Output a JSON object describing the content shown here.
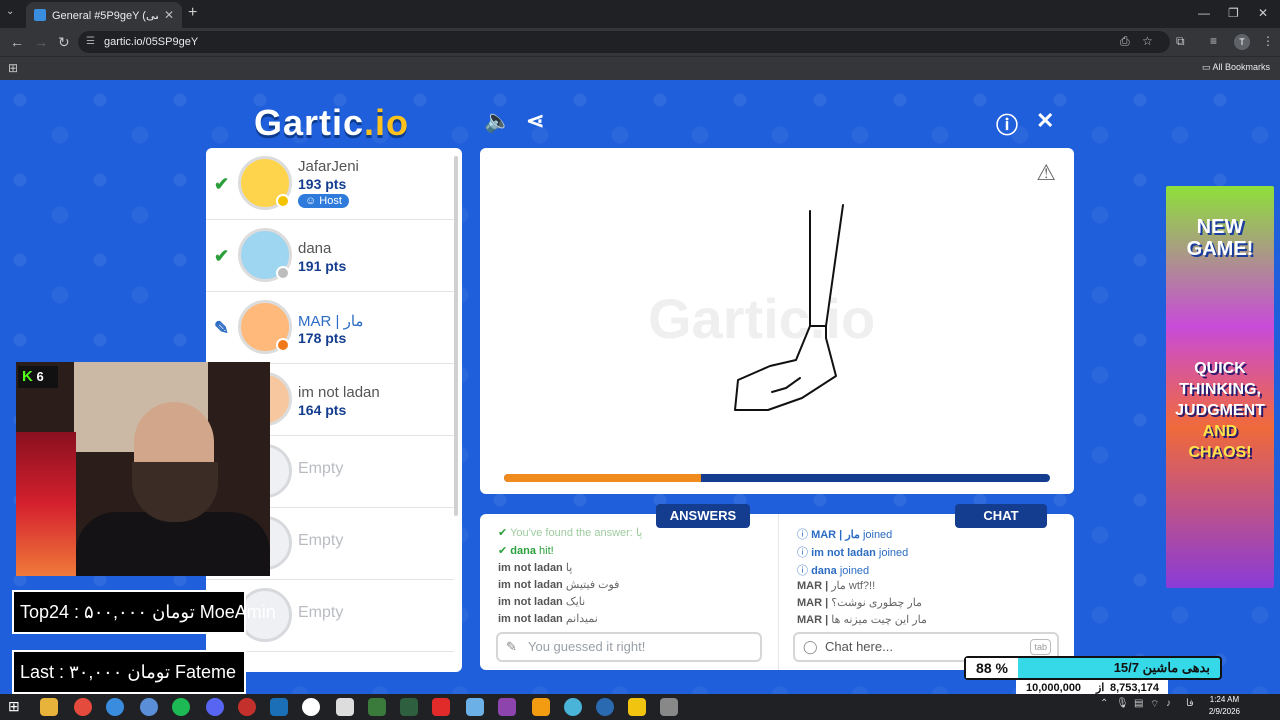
{
  "browser": {
    "tab_title": "General #5P9geY (فارسی) - Gartic",
    "tab_close": "✕",
    "new_tab": "+",
    "url": "gartic.io/05SP9geY",
    "bookmarks_label": "All Bookmarks",
    "profile_initial": "T",
    "menu_icon": "kebab-menu-icon"
  },
  "game": {
    "logo_main": "Gartic",
    "logo_suffix": ".io",
    "players": [
      {
        "name": "JafarJeni",
        "points": "193 pts",
        "status": "guessed",
        "host_label": "Host",
        "avatar_color": "#ffd44d",
        "dot_color": "#f5c400"
      },
      {
        "name": "dana",
        "points": "191 pts",
        "status": "guessed",
        "avatar_color": "#9ed5f0",
        "dot_color": "#bdbdbd"
      },
      {
        "name": "MAR | مار",
        "points": "178 pts",
        "status": "drawing",
        "avatar_color": "#ffb97a",
        "dot_color": "#f07a1a"
      },
      {
        "name": "im not ladan",
        "points": "164 pts",
        "status": "none",
        "avatar_color": "#f7c7a0",
        "dot_color": ""
      },
      {
        "name": "Empty",
        "status": "empty"
      },
      {
        "name": "Empty",
        "status": "empty"
      },
      {
        "name": "Empty",
        "status": "empty"
      }
    ],
    "canvas": {
      "watermark": "Gartic.io",
      "progress_fraction": 0.36
    },
    "answers": {
      "tab_label": "ANSWERS",
      "messages": [
        {
          "user": "",
          "text": "You've found the answer:",
          "word": "پا",
          "kind": "found"
        },
        {
          "user": "dana",
          "text": "hit!",
          "kind": "hit"
        },
        {
          "user": "im not ladan",
          "text": "پا",
          "kind": "guess"
        },
        {
          "user": "im not ladan",
          "text": "فوت فیتیش",
          "kind": "guess"
        },
        {
          "user": "im not ladan",
          "text": "نایک",
          "kind": "guess"
        },
        {
          "user": "im not ladan",
          "text": "نمیدانم",
          "kind": "guess"
        }
      ],
      "input_placeholder": "You guessed it right!"
    },
    "chat": {
      "tab_label": "CHAT",
      "messages": [
        {
          "user": "MAR | مار",
          "text": "joined",
          "kind": "join"
        },
        {
          "user": "im not ladan",
          "text": "joined",
          "kind": "join"
        },
        {
          "user": "dana",
          "text": "joined",
          "kind": "join"
        },
        {
          "user": "MAR |",
          "text": "مار wtf?!!",
          "kind": "msg"
        },
        {
          "user": "MAR |",
          "text": "مار چطوری نوشت؟",
          "kind": "msg"
        },
        {
          "user": "MAR |",
          "text": "مار این چیت میزنه ها",
          "kind": "msg"
        }
      ],
      "input_placeholder": "Chat here...",
      "tab_key": "tab"
    }
  },
  "ad": {
    "headline": "NEW GAME!",
    "tagline_1": "QUICK THINKING,",
    "tagline_2": "JUDGMENT",
    "tagline_3": "AND",
    "tagline_4": "CHAOS!"
  },
  "stream_overlay": {
    "kick_count": "6",
    "kick_logo": "K",
    "top_donor": "Top24 : ۵۰۰,۰۰۰ تومان  MoeAmin",
    "last_donor": "Last  :  ۳۰,۰۰۰ تومان  Fateme",
    "goal_percent": "88",
    "goal_percent_sign": "%",
    "goal_title": "بدهی ماشین 15/7",
    "goal_current": "8,753,174",
    "goal_of": "از",
    "goal_target": "10,000,000",
    "goal_fraction": 0.88
  },
  "taskbar": {
    "time": "1:24 AM",
    "date": "2/9/2026"
  }
}
